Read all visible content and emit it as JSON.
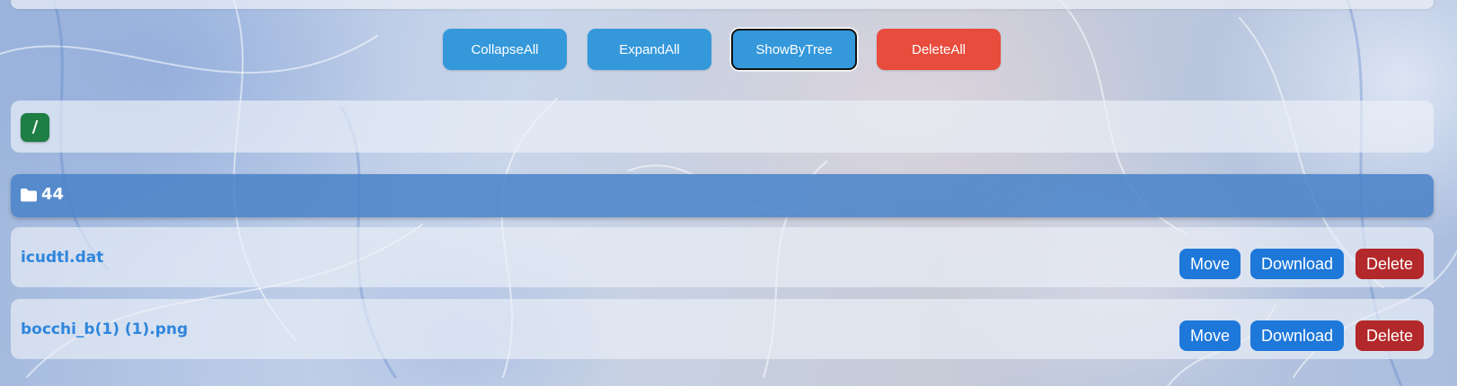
{
  "toolbar": {
    "collapse_all": "CollapseAll",
    "expand_all": "ExpandAll",
    "show_by_tree": "ShowByTree",
    "delete_all": "DeleteAll"
  },
  "path": {
    "root_label": "/"
  },
  "folder": {
    "icon": "folder-icon",
    "name": "44"
  },
  "files": [
    {
      "name": "icudtl.dat",
      "move_label": "Move",
      "download_label": "Download",
      "delete_label": "Delete"
    },
    {
      "name": "bocchi_b(1) (1).png",
      "move_label": "Move",
      "download_label": "Download",
      "delete_label": "Delete"
    }
  ],
  "colors": {
    "button_blue": "#3498db",
    "button_red": "#e74c3c",
    "root_badge_green": "#1e7e44",
    "folder_bar_blue": "#4882c8",
    "file_link_blue": "#2f86dc",
    "action_blue": "#1e78d9",
    "action_red": "#b3282a"
  }
}
